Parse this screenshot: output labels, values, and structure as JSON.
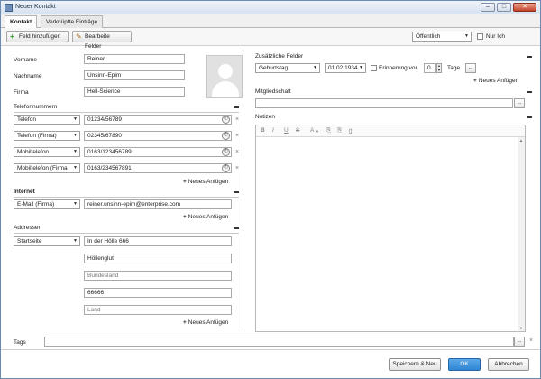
{
  "window": {
    "title": "Neuer Kontakt",
    "min": "–",
    "max": "□",
    "close": "✕"
  },
  "tabs": [
    "Kontakt",
    "Verknüpfte Einträge"
  ],
  "toolbar": {
    "add_field": "Feld hinzufügen",
    "edit_fields": "Bearbeite Felder",
    "visibility": "Öffentlich",
    "only_me": "Nur Ich"
  },
  "contact": {
    "first_name_label": "Vorname",
    "first_name": "Reiner",
    "last_name_label": "Nachname",
    "last_name": "Unsinn-Epim",
    "company_label": "Firma",
    "company": "Hell-Science"
  },
  "phones": {
    "title": "Telefonnummern",
    "rows": [
      {
        "type": "Telefon",
        "value": "01234/56789"
      },
      {
        "type": "Telefon (Firma)",
        "value": "02345/67890"
      },
      {
        "type": "Mobiltelefon",
        "value": "0163/123456789"
      },
      {
        "type": "Mobiltelefon (Firma",
        "value": "0163/234567891"
      }
    ],
    "add": "Neues Anfügen"
  },
  "internet": {
    "title": "Internet",
    "type": "E-Mail (Firma)",
    "value": "reiner.unsinn-epim@enterprise.com",
    "add": "Neues Anfügen"
  },
  "addresses": {
    "title": "Addressen",
    "type": "Startseite",
    "street": "In der Hölle 666",
    "city": "Höllenglut",
    "state_placeholder": "Bundesland",
    "zip": "66666",
    "country_placeholder": "Land",
    "add": "Neues Anfügen"
  },
  "extra": {
    "title": "Zusätzliche Felder",
    "field": "Geburtstag",
    "date": "01.02.1934",
    "reminder_label": "Erinnerung vor",
    "reminder_value": "0",
    "days": "Tage",
    "add": "Neues Anfügen"
  },
  "membership": {
    "title": "Mitgliedschaft"
  },
  "notes": {
    "title": "Notizen",
    "tools": [
      "B",
      "I",
      "U",
      "S",
      "A",
      "⎘",
      "⎘",
      "▯"
    ]
  },
  "tags": {
    "label": "Tags"
  },
  "footer": {
    "save_new": "Speichern & Neu",
    "ok": "OK",
    "cancel": "Abbrechen"
  },
  "icons": {
    "add": "plus-icon",
    "edit": "pencil-icon",
    "phone": "phone-icon",
    "remove": "close-icon",
    "more": "ellipsis-icon"
  },
  "colors": {
    "ok_button": "#2f86d3",
    "add_icon": "#2e9b2e",
    "window_border": "#6d8bb0"
  }
}
